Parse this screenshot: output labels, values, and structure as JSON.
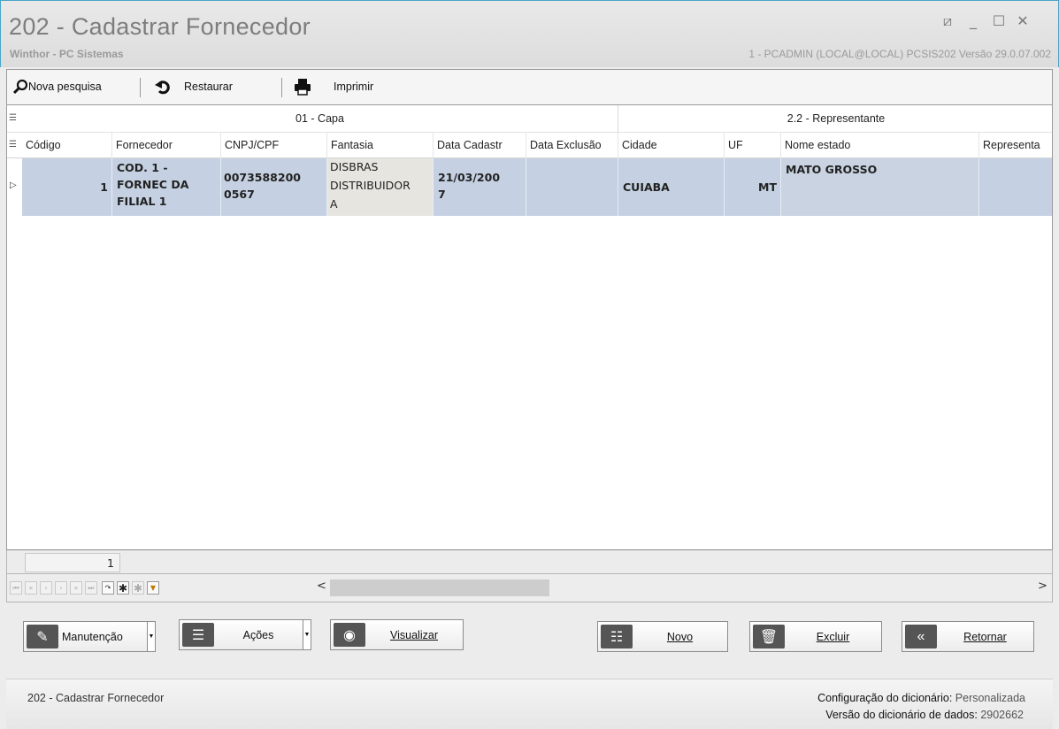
{
  "window": {
    "title": "202 - Cadastrar  Fornecedor",
    "subtitle": "Winthor - PC Sistemas",
    "userinfo": "1 - PCADMIN (LOCAL@LOCAL)   PCSIS202  Versão  29.0.07.002",
    "controls": {
      "restore": "⧄",
      "minimize": "_",
      "maximize": "☐",
      "close": "✕"
    }
  },
  "toolbar": {
    "new_search": "Nova pesquisa",
    "restore": "Restaurar",
    "print": "Imprimir"
  },
  "grid": {
    "bands": [
      "01 - Capa",
      "2.2 - Representante"
    ],
    "columns": [
      "Código",
      "Fornecedor",
      "CNPJ/CPF",
      "Fantasia",
      "Data Cadastr",
      "Data Exclusão",
      "Cidade",
      "UF",
      "Nome estado",
      "Representa"
    ],
    "row": {
      "codigo": "1",
      "fornecedor": [
        "COD. 1 -",
        "FORNEC DA",
        "FILIAL 1"
      ],
      "cnpj": [
        "0073588200",
        "0567"
      ],
      "fantasia": [
        "DISBRAS",
        "DISTRIBUIDOR",
        "A"
      ],
      "data_cadastro": [
        "21/03/200",
        "7"
      ],
      "data_exclusao": "",
      "cidade": "CUIABA",
      "uf": "MT",
      "nome_estado": "MATO GROSSO",
      "representante": ""
    },
    "record_count": "1"
  },
  "actions": {
    "manutencao": "Manutenção",
    "acoes": "Ações",
    "visualizar": "Visualizar",
    "novo": "Novo",
    "excluir": "Excluir",
    "retornar": "Retornar"
  },
  "status": {
    "screen": "202 - Cadastrar  Fornecedor",
    "config_label": "Configuração do dicionário:",
    "config_value": "Personalizada",
    "version_label": "Versão do dicionário de dados:",
    "version_value": "2902662"
  }
}
